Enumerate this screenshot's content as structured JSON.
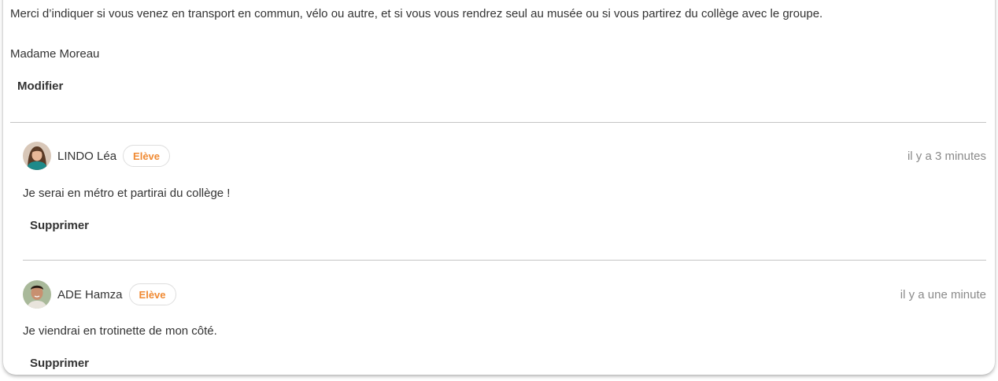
{
  "post": {
    "body": "Merci d’indiquer si vous venez en transport en commun, vélo ou autre, et si vous vous rendrez seul au musée ou si vous partirez du collège avec le groupe.",
    "signature": "Madame Moreau",
    "edit_label": "Modifier"
  },
  "comments": [
    {
      "author": "LINDO Léa",
      "role": "Elève",
      "time": "il y a 3 minutes",
      "text": "Je serai en métro et partirai du collège !",
      "delete_label": "Supprimer"
    },
    {
      "author": "ADE Hamza",
      "role": "Elève",
      "time": "il y a une minute",
      "text": "Je viendrai en trotinette de mon côté.",
      "delete_label": "Supprimer"
    }
  ],
  "colors": {
    "badge_text": "#f08a33",
    "timestamp": "#8a8a8a",
    "divider": "#c4c4c4"
  },
  "icons": {
    "avatar_1": "avatar-girl",
    "avatar_2": "avatar-boy"
  }
}
